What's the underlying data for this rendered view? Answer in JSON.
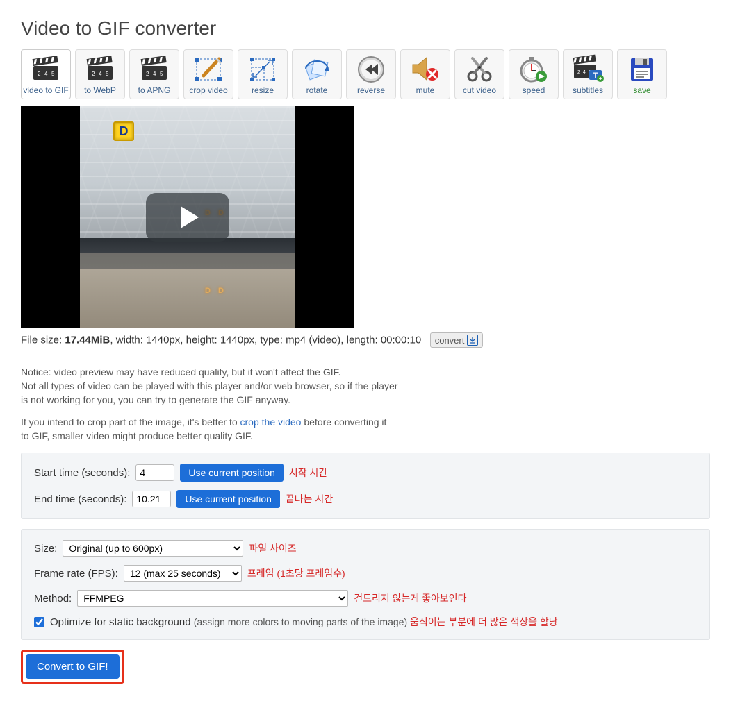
{
  "page_title": "Video to GIF converter",
  "toolbar": [
    {
      "id": "video-to-gif",
      "label": "video to GIF",
      "active": true,
      "green": false
    },
    {
      "id": "to-webp",
      "label": "to WebP",
      "active": false,
      "green": false
    },
    {
      "id": "to-apng",
      "label": "to APNG",
      "active": false,
      "green": false
    },
    {
      "id": "crop-video",
      "label": "crop video",
      "active": false,
      "green": false
    },
    {
      "id": "resize",
      "label": "resize",
      "active": false,
      "green": false
    },
    {
      "id": "rotate",
      "label": "rotate",
      "active": false,
      "green": false
    },
    {
      "id": "reverse",
      "label": "reverse",
      "active": false,
      "green": false
    },
    {
      "id": "mute",
      "label": "mute",
      "active": false,
      "green": false
    },
    {
      "id": "cut-video",
      "label": "cut video",
      "active": false,
      "green": false
    },
    {
      "id": "speed",
      "label": "speed",
      "active": false,
      "green": false
    },
    {
      "id": "subtitles",
      "label": "subtitles",
      "active": false,
      "green": false
    },
    {
      "id": "save",
      "label": "save",
      "active": false,
      "green": true
    }
  ],
  "preview": {
    "gate_letter": "D",
    "dd_text": "D D"
  },
  "file_info": {
    "size_label": "File size: ",
    "size_value": "17.44MiB",
    "rest": ", width: 1440px, height: 1440px, type: mp4 (video), length: 00:00:10",
    "convert_label": "convert"
  },
  "notice": {
    "line1": "Notice: video preview may have reduced quality, but it won't affect the GIF.",
    "line2": "Not all types of video can be played with this player and/or web browser, so if the player",
    "line3": "is not working for you, you can try to generate the GIF anyway.",
    "line4a": "If you intend to crop part of the image, it's better to ",
    "crop_link": "crop the video",
    "line4b": " before converting it",
    "line5": "to GIF, smaller video might produce better quality GIF."
  },
  "time_panel": {
    "start_label": "Start time (seconds):",
    "start_value": "4",
    "start_note": "시작 시간",
    "end_label": "End time (seconds):",
    "end_value": "10.21",
    "end_note": "끝나는 시간",
    "use_current": "Use current position"
  },
  "options": {
    "size_label": "Size:",
    "size_value": "Original (up to 600px)",
    "size_note": "파일 사이즈",
    "fps_label": "Frame rate (FPS):",
    "fps_value": "12 (max 25 seconds)",
    "fps_note": "프레임 (1초당 프레임수)",
    "method_label": "Method:",
    "method_value": "FFMPEG",
    "method_note": "건드리지 않는게 좋아보인다",
    "optimize_label": "Optimize for static background ",
    "optimize_paren": "(assign more colors to moving parts of the image) ",
    "optimize_note": "움직이는 부분에 더 많은 색상을 할당",
    "optimize_checked": true
  },
  "convert_button": "Convert to GIF!"
}
